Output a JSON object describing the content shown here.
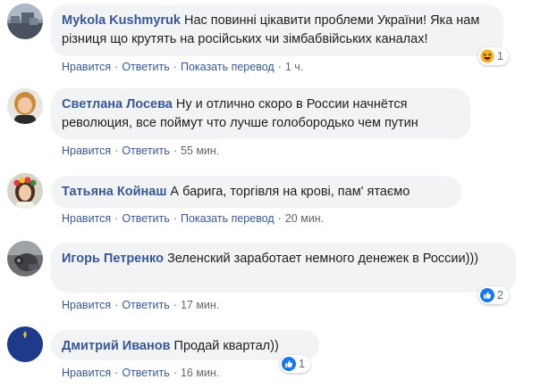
{
  "actions": {
    "like": "Нравится",
    "reply": "Ответить",
    "translate": "Показать перевод"
  },
  "comments": [
    {
      "author": "Mykola Kushmyruk",
      "text": "Нас повинні цікавити проблеми України! Яка нам різниця що крутять на російських чи зімбабвійських каналах!",
      "time": "1 ч.",
      "reaction": {
        "icon": "haha-reaction-icon",
        "count": "1"
      }
    },
    {
      "author": "Светлана Лосева",
      "text": "Ну и отлично скоро в России начнётся революция, все поймут что лучше голобородько чем путин",
      "time": "55 мин."
    },
    {
      "author": "Татьяна Койнаш",
      "text": "А барига, торгівля на крові, пам' ятаємо",
      "time": "20 мин."
    },
    {
      "author": "Игорь Петренко",
      "text": "Зеленский заработает немного денежек в России)))",
      "time": "17 мин.",
      "reaction": {
        "icon": "like-reaction-icon",
        "count": "2"
      }
    },
    {
      "author": "Дмитрий Иванов",
      "text": "Продай квартал))",
      "time": "16 мин.",
      "reaction": {
        "icon": "like-reaction-icon",
        "count": "1"
      },
      "avatar_text": "I'M UKRAINIAN AND I CANNOT KEEP CALM"
    }
  ],
  "colors": {
    "author": "#385898",
    "bubble": "#f2f3f5",
    "meta": "#606770",
    "like_blue": "#1877f2",
    "haha_yellow": "#f7b125"
  }
}
